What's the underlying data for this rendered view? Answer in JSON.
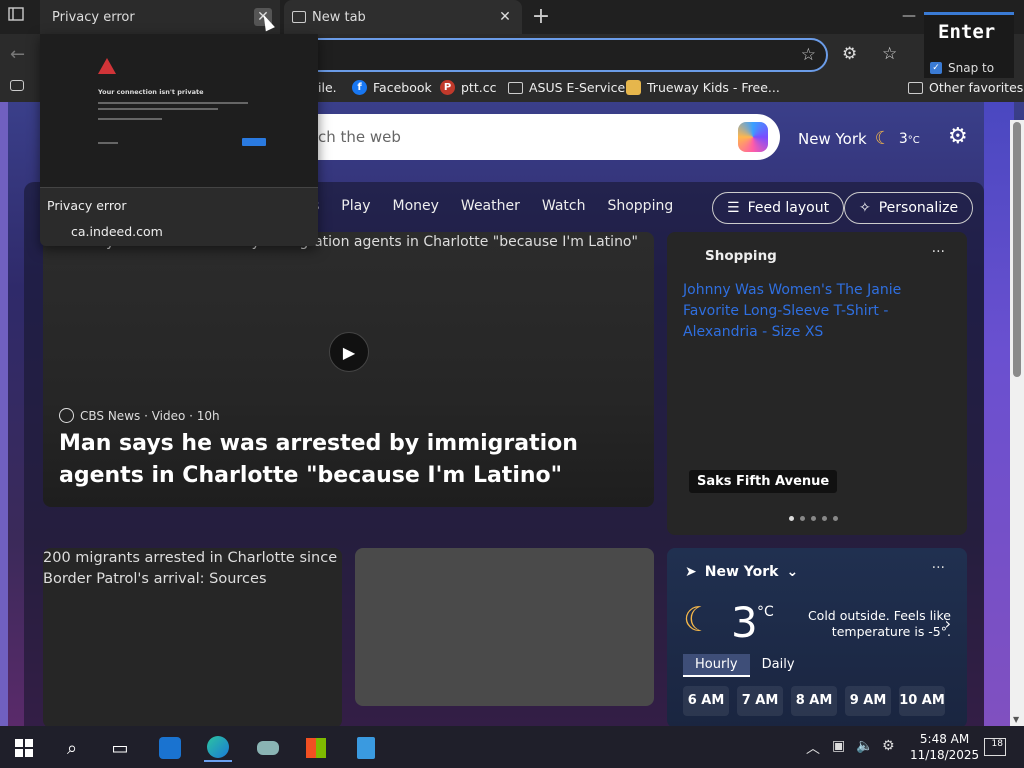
{
  "tabs": [
    {
      "title": "Privacy error",
      "active": true
    },
    {
      "title": "New tab",
      "active": false
    }
  ],
  "favorites": [
    {
      "label": "ile.",
      "icon": ""
    },
    {
      "label": "Facebook",
      "icon": "facebook-icon",
      "color": "#1877f2"
    },
    {
      "label": "ptt.cc",
      "icon": "ptt-icon",
      "color": "#c0392b"
    },
    {
      "label": "ASUS E-Service",
      "icon": "folder-icon"
    },
    {
      "label": "Trueway Kids - Free...",
      "icon": "trueway-icon"
    },
    {
      "label": "Other favorites",
      "icon": "folder-icon"
    }
  ],
  "search": {
    "placeholder": "ch the web"
  },
  "header_weather": {
    "city": "New York",
    "temp": "3",
    "unit": "°C"
  },
  "nav": {
    "partial": "s",
    "items": [
      "Play",
      "Money",
      "Weather",
      "Watch",
      "Shopping"
    ],
    "feed_layout": "Feed layout",
    "personalize": "Personalize"
  },
  "hero": {
    "image_alt": "...an says he was arrested by immigration agents in Charlotte \"because I'm Latino\"",
    "source": "CBS News · Video · 10h",
    "headline": "Man says he was arrested by immigration agents in Charlotte \"because I'm Latino\""
  },
  "shopping": {
    "title": "Shopping",
    "image_alt": "Johnny Was Women's The Janie Favorite Long-Sleeve T-Shirt - Alexandria - Size XS",
    "brand": "Saks Fifth Avenue",
    "more": "···"
  },
  "card2": {
    "image_alt": "200 migrants arrested in Charlotte since Border Patrol's arrival: Sources"
  },
  "weather": {
    "city": "New York",
    "temp": "3",
    "unit": "°C",
    "description": "Cold outside. Feels like temperature is -5°.",
    "tabs": [
      "Hourly",
      "Daily"
    ],
    "hours": [
      "6 AM",
      "7 AM",
      "8 AM",
      "9 AM",
      "10 AM"
    ]
  },
  "preview": {
    "page_title": "Your connection isn't private",
    "tab_name": "Privacy error",
    "url": "ca.indeed.com"
  },
  "key_overlay": {
    "key": "Enter",
    "snap_label": "Snap to"
  },
  "clock": {
    "time": "5:48 AM",
    "date": "11/18/2025"
  },
  "notifications": {
    "count": "18"
  }
}
